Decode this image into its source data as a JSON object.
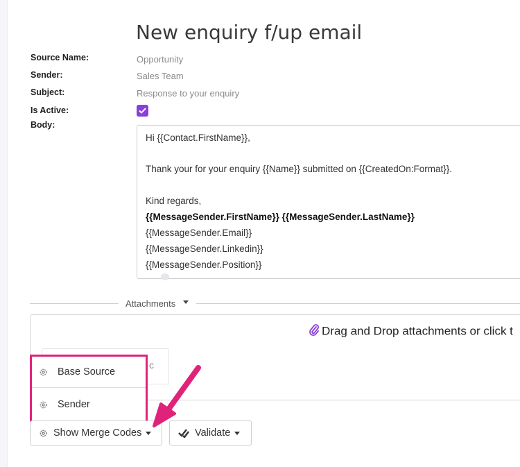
{
  "page": {
    "title": "New enquiry f/up email"
  },
  "fields": {
    "source_name_label": "Source Name:",
    "source_name_value": "Opportunity",
    "sender_label": "Sender:",
    "sender_value": "Sales Team",
    "subject_label": "Subject:",
    "subject_value": "Response to your enquiry",
    "is_active_label": "Is Active:",
    "is_active_checked": true,
    "body_label": "Body:"
  },
  "body_lines": [
    "Hi {{Contact.FirstName}},",
    "Thank your for your enquiry {{Name}} submitted on {{CreatedOn:Format}}.",
    "Kind regards,",
    "{{MessageSender.FirstName}} {{MessageSender.LastName}}",
    "{{MessageSender.Email}}",
    "{{MessageSender.Linkedin}}",
    "{{MessageSender.Position}}"
  ],
  "attachments": {
    "label": "Attachments",
    "dropzone_text": "Drag and Drop attachments or click t",
    "ghost_char": "c"
  },
  "merge_menu": {
    "items": [
      "Base Source",
      "Sender"
    ]
  },
  "buttons": {
    "show_merge_codes": "Show Merge Codes",
    "validate": "Validate"
  },
  "colors": {
    "accent_purple": "#8b3fd9",
    "highlight_pink": "#e0237a"
  },
  "icons": {
    "gear": "gear-icon",
    "paperclip": "paperclip-icon",
    "double-check": "double-check-icon",
    "checkbox-check": "check-icon",
    "caret": "caret-down-icon"
  }
}
